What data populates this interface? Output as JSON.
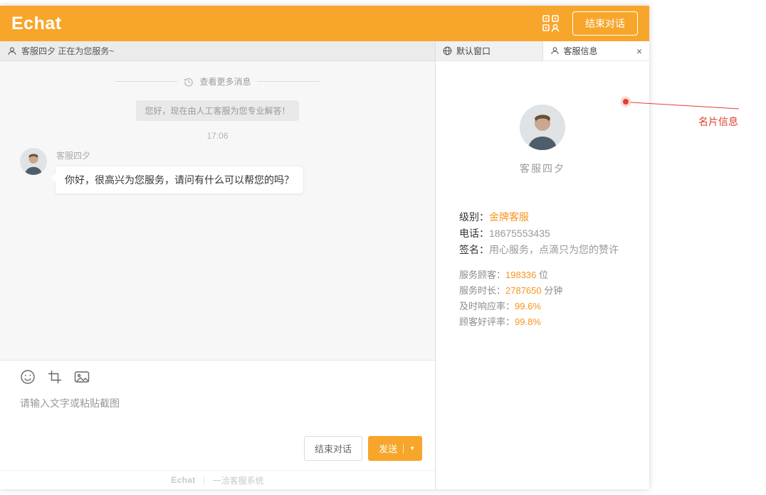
{
  "colors": {
    "brand_orange": "#F7A62B",
    "highlight_orange": "#F7941E",
    "annotation_red": "#E0402E"
  },
  "header": {
    "logo": "Echat",
    "end_chat": "结束对话"
  },
  "chat": {
    "status": "客服四夕 正在为您服务~",
    "load_more": "查看更多消息",
    "system_message": "您好，现在由人工客服为您专业解答！",
    "time": "17:06",
    "messages": [
      {
        "sender": "客服四夕",
        "text": "你好，很高兴为您服务，请问有什么可以帮您的吗？"
      }
    ],
    "composer": {
      "placeholder": "请输入文字或粘贴截图",
      "end_chat": "结束对话",
      "send": "发送"
    },
    "footer": {
      "brand": "Echat",
      "divider": "｜",
      "name": "一洽客服系统"
    }
  },
  "panel": {
    "tabs": [
      {
        "label": "默认窗口",
        "active": false
      },
      {
        "label": "客服信息",
        "active": true
      }
    ],
    "agent": {
      "name": "客服四夕",
      "info": [
        {
          "label": "级别：",
          "value": "金牌客服"
        },
        {
          "label": "电话：",
          "value": "18675553435"
        },
        {
          "label": "签名：",
          "value": "用心服务，点滴只为您的赞许"
        }
      ],
      "stats": [
        {
          "label": "服务顾客：",
          "value": "198336",
          "suffix": " 位"
        },
        {
          "label": "服务时长：",
          "value": "2787650",
          "suffix": " 分钟"
        },
        {
          "label": "及时响应率：",
          "value": "99.6%",
          "suffix": ""
        },
        {
          "label": "顾客好评率：",
          "value": "99.8%",
          "suffix": ""
        }
      ]
    }
  },
  "annotation": {
    "label": "名片信息"
  },
  "icons": {
    "header_qr": "qr-contact-icon",
    "topbar_agent": "agent-icon",
    "tab_default": "globe-icon",
    "tab_agent": "person-icon",
    "load_more": "history-clock-icon",
    "emoji": "smiley-icon",
    "screenshot": "crop-icon",
    "image": "picture-icon",
    "send_caret": "▼",
    "close": "×"
  }
}
